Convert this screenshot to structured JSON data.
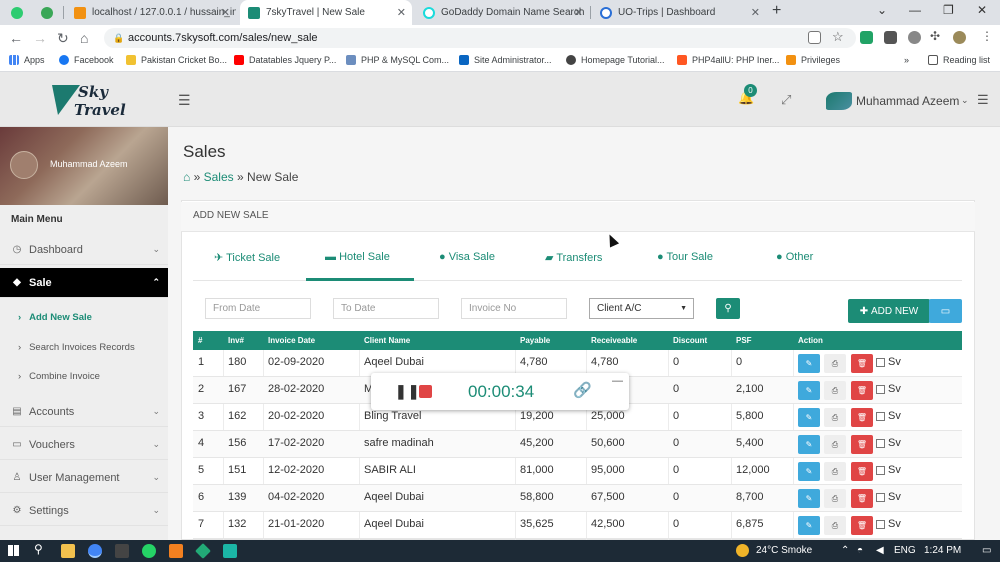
{
  "browser": {
    "tabs": [
      {
        "label": ""
      },
      {
        "label": ""
      },
      {
        "label": "localhost / 127.0.0.1 / hussain_in"
      },
      {
        "label": "7skyTravel | New Sale"
      },
      {
        "label": "GoDaddy Domain Name Search"
      },
      {
        "label": "UO-Trips | Dashboard"
      }
    ],
    "new_tab": "+",
    "url": "accounts.7skysoft.com/sales/new_sale",
    "bookmarks": [
      "Apps",
      "Facebook",
      "Pakistan Cricket Bo...",
      "Datatables Jquery P...",
      "PHP & MySQL Com...",
      "Site Administrator...",
      "Homepage Tutorial...",
      "PHP4allU: PHP Iner...",
      "Privileges"
    ],
    "more_bookmarks": "»",
    "reading_list": "Reading list"
  },
  "header": {
    "logo_line1": "Sky",
    "logo_line2": "Travel",
    "notif_count": "0",
    "user_name": "Muhammad Azeem"
  },
  "sidebar": {
    "profile_name": "Muhammad Azeem",
    "main_menu": "Main Menu",
    "items": [
      {
        "label": "Dashboard"
      },
      {
        "label": "Sale"
      },
      {
        "label": "Accounts"
      },
      {
        "label": "Vouchers"
      },
      {
        "label": "User Management"
      },
      {
        "label": "Settings"
      }
    ],
    "sub_items": [
      "Add New Sale",
      "Search Invoices Records",
      "Combine Invoice"
    ]
  },
  "page": {
    "title": "Sales",
    "breadcrumb_link": "Sales",
    "breadcrumb_sep1": "»",
    "breadcrumb_sep2": "»",
    "breadcrumb_current": "New Sale",
    "panel_title": "ADD NEW SALE",
    "tabs": [
      "Ticket Sale",
      "Hotel Sale",
      "Visa Sale",
      "Transfers",
      "Tour Sale",
      "Other"
    ],
    "filters": {
      "from_date": "From Date",
      "to_date": "To Date",
      "invoice_no": "Invoice No",
      "client_select": "Client A/C"
    },
    "add_new": "ADD NEW"
  },
  "table": {
    "headers": [
      "#",
      "Inv#",
      "Invoice Date",
      "Client Name",
      "Payable",
      "Receiveable",
      "Discount",
      "PSF",
      "Action"
    ],
    "rows": [
      {
        "n": "1",
        "inv": "180",
        "date": "02-09-2020",
        "client": "Aqeel Dubai",
        "payable": "4,780",
        "recv": "4,780",
        "disc": "0",
        "psf": "0"
      },
      {
        "n": "2",
        "inv": "167",
        "date": "28-02-2020",
        "client": "M",
        "payable": "",
        "recv": "",
        "disc": "0",
        "psf": "2,100"
      },
      {
        "n": "3",
        "inv": "162",
        "date": "20-02-2020",
        "client": "Bling Travel",
        "payable": "19,200",
        "recv": "25,000",
        "disc": "0",
        "psf": "5,800"
      },
      {
        "n": "4",
        "inv": "156",
        "date": "17-02-2020",
        "client": "safre madinah",
        "payable": "45,200",
        "recv": "50,600",
        "disc": "0",
        "psf": "5,400"
      },
      {
        "n": "5",
        "inv": "151",
        "date": "12-02-2020",
        "client": "SABIR ALI",
        "payable": "81,000",
        "recv": "95,000",
        "disc": "0",
        "psf": "12,000"
      },
      {
        "n": "6",
        "inv": "139",
        "date": "04-02-2020",
        "client": "Aqeel Dubai",
        "payable": "58,800",
        "recv": "67,500",
        "disc": "0",
        "psf": "8,700"
      },
      {
        "n": "7",
        "inv": "132",
        "date": "21-01-2020",
        "client": "Aqeel Dubai",
        "payable": "35,625",
        "recv": "42,500",
        "disc": "0",
        "psf": "6,875"
      }
    ],
    "sv_label": "Sv"
  },
  "recorder": {
    "time": "00:00:34"
  },
  "taskbar": {
    "weather": "24°C  Smoke",
    "lang": "ENG",
    "time": "1:24 PM"
  },
  "colors": {
    "accent": "#1c8c76",
    "edit": "#3fa9dc",
    "delete": "#e04545"
  }
}
